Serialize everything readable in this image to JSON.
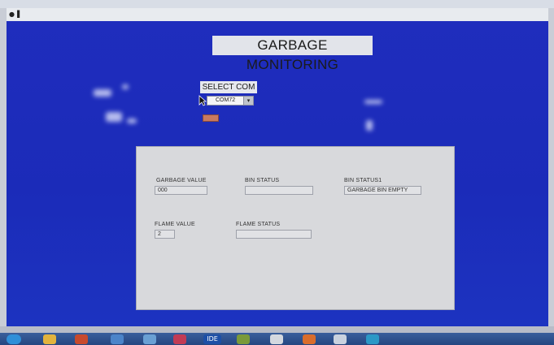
{
  "window": {
    "system_icon": "●▐",
    "title": "GARBAGE MONITORING"
  },
  "serial": {
    "label": "SELECT COM",
    "selected_port": "COM72",
    "dropdown_arrow": "▾"
  },
  "panel": {
    "garbage_value": {
      "label": "GARBAGE VALUE",
      "value": "000"
    },
    "bin_status": {
      "label": "BIN STATUS",
      "value": ""
    },
    "bin_status1": {
      "label": "BIN STATUS1",
      "value": "GARBAGE BIN EMPTY"
    },
    "flame_value": {
      "label": "FLAME VALUE",
      "value": "2"
    },
    "flame_status": {
      "label": "FLAME STATUS",
      "value": ""
    }
  },
  "taskbar": {
    "items": [
      "windows-start-icon",
      "folder-icon",
      "media-player-icon",
      "internet-explorer-icon",
      "app-icon",
      "app-icon",
      "ide-icon",
      "app-icon",
      "app-icon",
      "app-icon",
      "app-icon",
      "app-icon"
    ],
    "ide_text": "IDE"
  },
  "colors": {
    "window_background": "#1f2dbd",
    "panel_background": "#d8d9dc",
    "start_button": "#c87a60",
    "taskbar": "#2f5290"
  }
}
